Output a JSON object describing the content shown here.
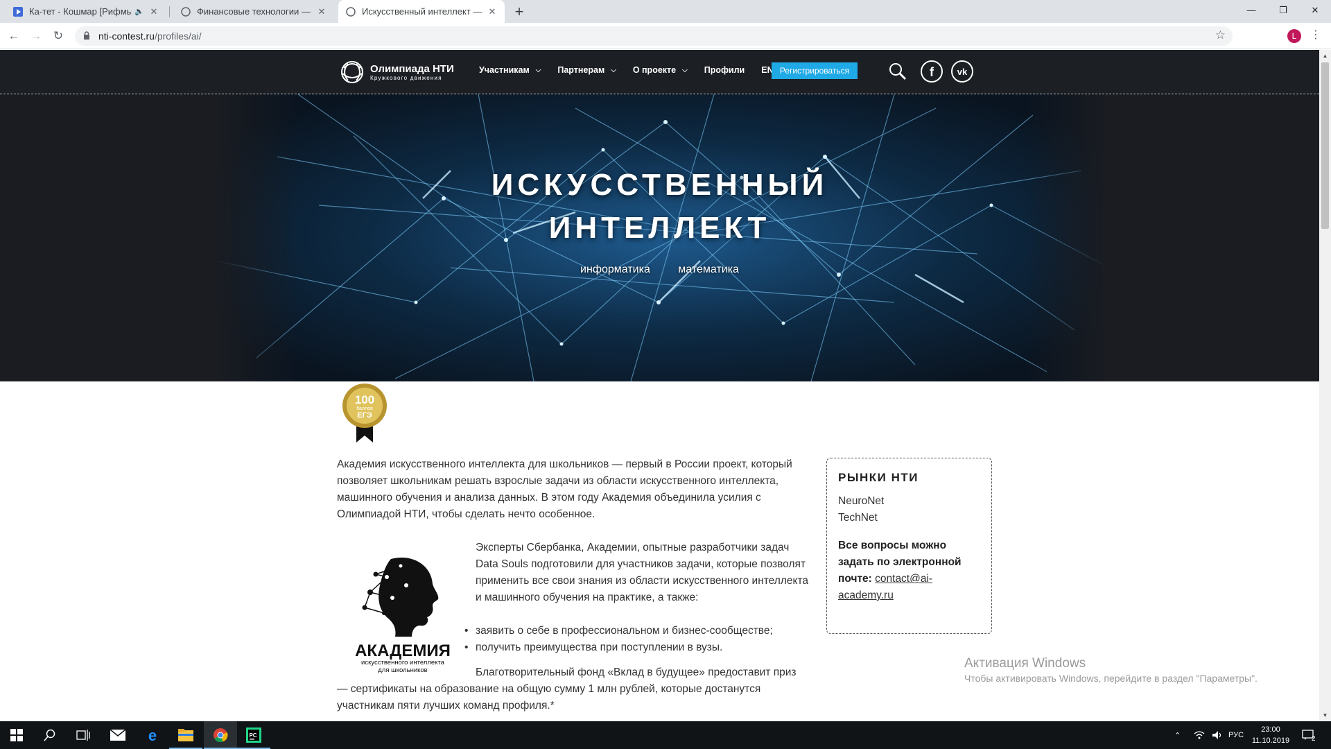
{
  "browser": {
    "tabs": [
      {
        "title": "Ка-тет - Кошмар [Рифмы и"
      },
      {
        "title": "Финансовые технологии — Оли"
      },
      {
        "title": "Искусственный интеллект — Ол"
      }
    ],
    "url_host": "nti-contest.ru",
    "url_path": "/profiles/ai/",
    "profile_initial": "L"
  },
  "site": {
    "logo_title": "Олимпиада НТИ",
    "logo_subtitle": "Кружкового движения",
    "menu": [
      {
        "label": "Участникам"
      },
      {
        "label": "Партнерам"
      },
      {
        "label": "О проекте"
      },
      {
        "label": "Профили"
      },
      {
        "label": "EN"
      }
    ],
    "register_label": "Регистрироваться"
  },
  "hero": {
    "title_line1": "ИСКУССТВЕННЫЙ",
    "title_line2": "ИНТЕЛЛЕКТ",
    "tags": [
      "информатика",
      "математика"
    ]
  },
  "badge": {
    "line1": "100",
    "line2": "баллов",
    "line3": "ЕГЭ"
  },
  "content": {
    "para1": "Академия искусственного интеллекта для школьников — первый в России проект, который позволяет школьникам решать взрослые задачи из области искусственного интеллекта, машинного обучения и анализа данных. В этом году Академия объединила усилия с Олимпиадой НТИ, чтобы сделать нечто особенное.",
    "para2": "Эксперты Сбербанка, Академии, опытные разработчики задач Data Souls подготовили для участников задачи, которые позволят применить все свои знания из области искусственного интеллекта и машинного обучения на практике, а также:",
    "bullets": [
      "заявить о себе в профессиональном и бизнес-сообществе;",
      "получить преимущества при поступлении в вузы."
    ],
    "para3": "Благотворительный фонд «Вклад в будущее» предоставит приз — сертификаты на образование на общую сумму 1 млн рублей, которые достанутся участникам пяти лучших команд профиля.*",
    "ai_logo_title": "АКАДЕМИЯ",
    "ai_logo_sub1": "искусственного интеллекта",
    "ai_logo_sub2": "для школьников"
  },
  "sidebox": {
    "heading": "РЫНКИ НТИ",
    "markets": [
      "NeuroNet",
      "TechNet"
    ],
    "question": "Все вопросы можно задать по электронной почте:",
    "email_line1": "contact@ai-",
    "email_line2": "academy.ru"
  },
  "activation": {
    "title": "Активация Windows",
    "subtitle": "Чтобы активировать Windows, перейдите в раздел \"Параметры\"."
  },
  "taskbar": {
    "lang": "РУС",
    "time": "23:00",
    "date": "11.10.2019",
    "notifications": "2"
  },
  "colors": {
    "header_bg": "#1c1f24",
    "accent": "#1fa9e6",
    "taskbar": "#101417"
  }
}
